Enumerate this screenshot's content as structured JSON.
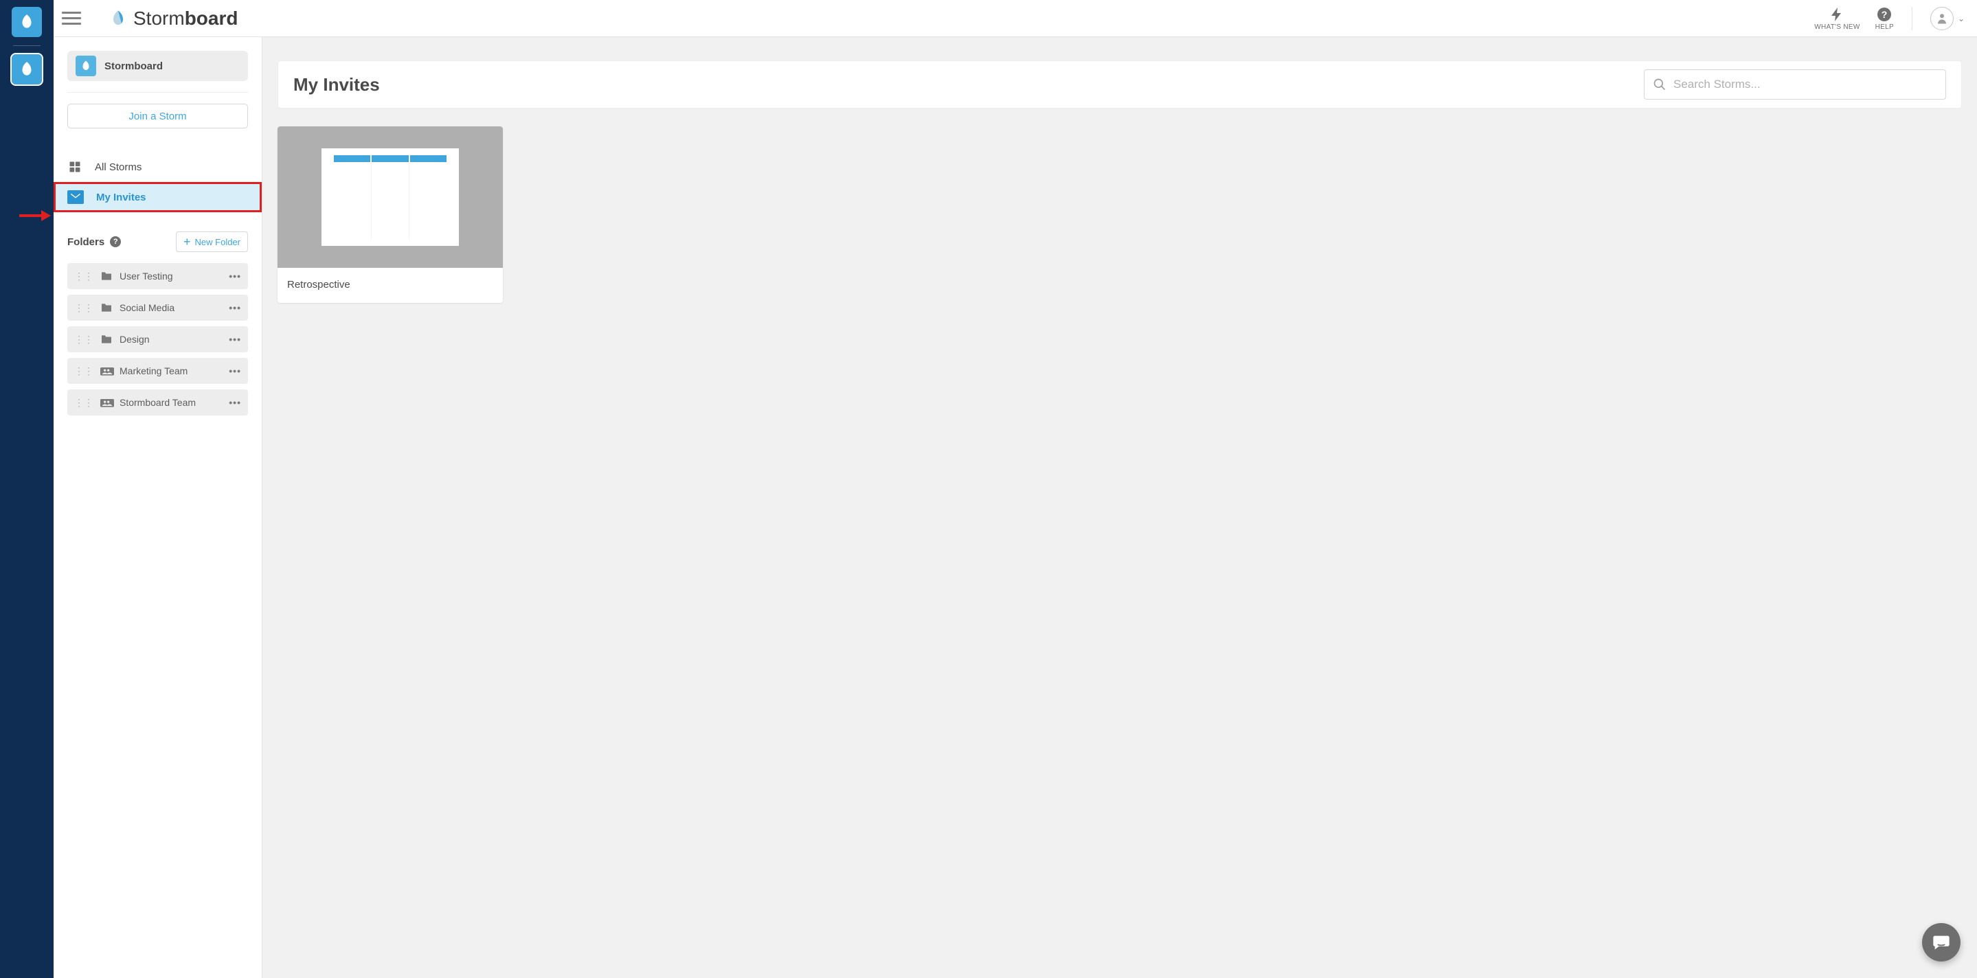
{
  "topbar": {
    "brand_light": "Storm",
    "brand_bold": "board",
    "whats_new": "WHAT'S NEW",
    "help": "HELP"
  },
  "sidebar": {
    "workspace": "Stormboard",
    "join_button": "Join a Storm",
    "nav": {
      "all_storms": "All Storms",
      "my_invites": "My Invites"
    },
    "folders_header": "Folders",
    "new_folder_button": "New Folder",
    "folders": [
      {
        "name": "User Testing",
        "type": "folder"
      },
      {
        "name": "Social Media",
        "type": "folder"
      },
      {
        "name": "Design",
        "type": "folder"
      },
      {
        "name": "Marketing Team",
        "type": "team"
      },
      {
        "name": "Stormboard Team",
        "type": "team"
      }
    ]
  },
  "main": {
    "title": "My Invites",
    "search_placeholder": "Search Storms...",
    "cards": [
      {
        "title": "Retrospective"
      }
    ]
  }
}
